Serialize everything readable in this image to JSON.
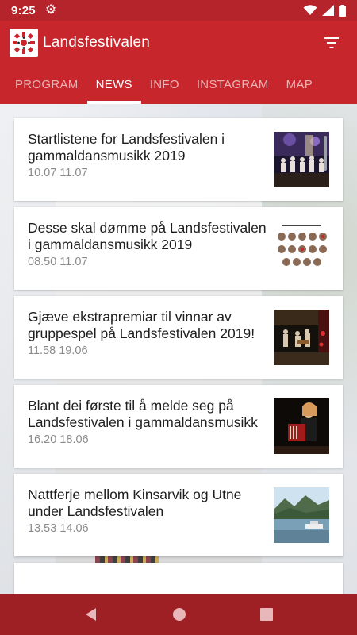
{
  "status_bar": {
    "time": "9:25",
    "icons": [
      "gear-icon",
      "wifi-icon",
      "signal-icon",
      "battery-icon"
    ]
  },
  "app_bar": {
    "title": "Landsfestivalen",
    "logo_icon": "festival-logo-icon",
    "filter_icon": "filter-icon"
  },
  "tabs": [
    {
      "label": "PROGRAM",
      "active": false
    },
    {
      "label": "NEWS",
      "active": true
    },
    {
      "label": "INFO",
      "active": false
    },
    {
      "label": "INSTAGRAM",
      "active": false
    },
    {
      "label": "MAP",
      "active": false
    }
  ],
  "news": [
    {
      "title": "Startlistene for Landsfestivalen i gammaldansmusikk 2019",
      "date": "10.07 11.07",
      "thumbnail": "stage-performance-photo"
    },
    {
      "title": "Desse skal dømme på Landsfestivalen i gammaldansmusikk 2019",
      "date": "08.50 11.07",
      "thumbnail": "judges-portraits-grid"
    },
    {
      "title": "Gjæve ekstrapremiar til vinnar av gruppespel på Landsfestivalen 2019!",
      "date": "11.58 19.06",
      "thumbnail": "group-musicians-photo"
    },
    {
      "title": "Blant dei første til å melde seg på Landsfestivalen i gammaldansmusikk",
      "date": "16.20 18.06",
      "thumbnail": "accordion-player-photo"
    },
    {
      "title": "Nattferje mellom Kinsarvik og Utne under Landsfestivalen",
      "date": "13.53 14.06",
      "thumbnail": "fjord-landscape-photo"
    }
  ],
  "colors": {
    "primary": "#c8262d",
    "status_bar": "#b5242a",
    "nav_bar": "#9e1f24"
  },
  "nav_bar": {
    "icons": [
      "back-icon",
      "home-icon",
      "recents-icon"
    ]
  }
}
